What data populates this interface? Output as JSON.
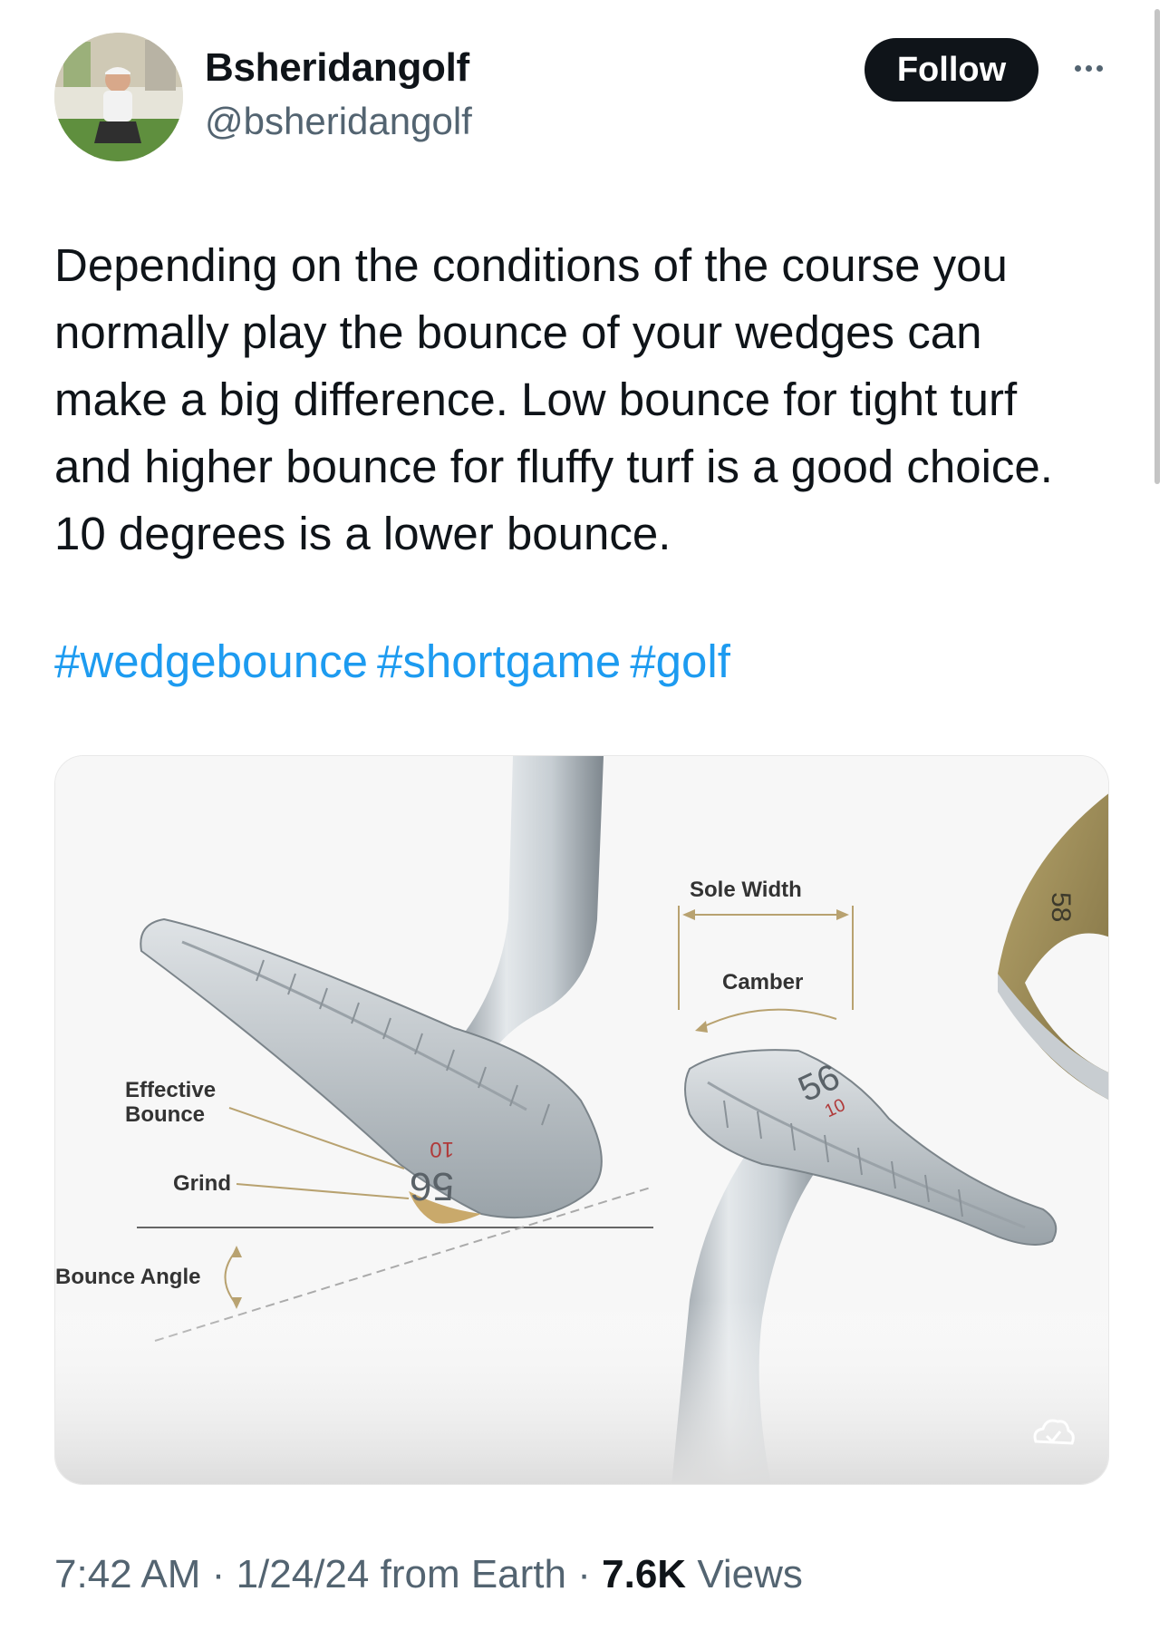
{
  "author": {
    "name": "Bsheridangolf",
    "handle": "@bsheridangolf"
  },
  "follow_label": "Follow",
  "tweet_text": "Depending on the conditions of the course you normally play the bounce of your wedges can make a big difference. Low bounce for tight turf and higher bounce for fluffy turf is a good choice. 10 degrees is a lower bounce.",
  "hashtags": [
    "#wedgebounce",
    "#shortgame",
    "#golf"
  ],
  "image": {
    "labels": {
      "effective_bounce_1": "Effective",
      "effective_bounce_2": "Bounce",
      "grind": "Grind",
      "bounce_angle": "Bounce Angle",
      "sole_width": "Sole Width",
      "camber": "Camber"
    },
    "club_markings": {
      "loft": "56",
      "bounce": "10",
      "right_loft": "58"
    }
  },
  "meta": {
    "time": "7:42 AM",
    "date": "1/24/24",
    "location": "from Earth",
    "sep": "·",
    "views_count": "7.6K",
    "views_label": "Views"
  },
  "colors": {
    "link": "#1d9bf0",
    "text": "#0f1419",
    "secondary": "#536471",
    "button": "#0f1419"
  },
  "icons": [
    "more-options-icon",
    "cloud-check-icon"
  ]
}
